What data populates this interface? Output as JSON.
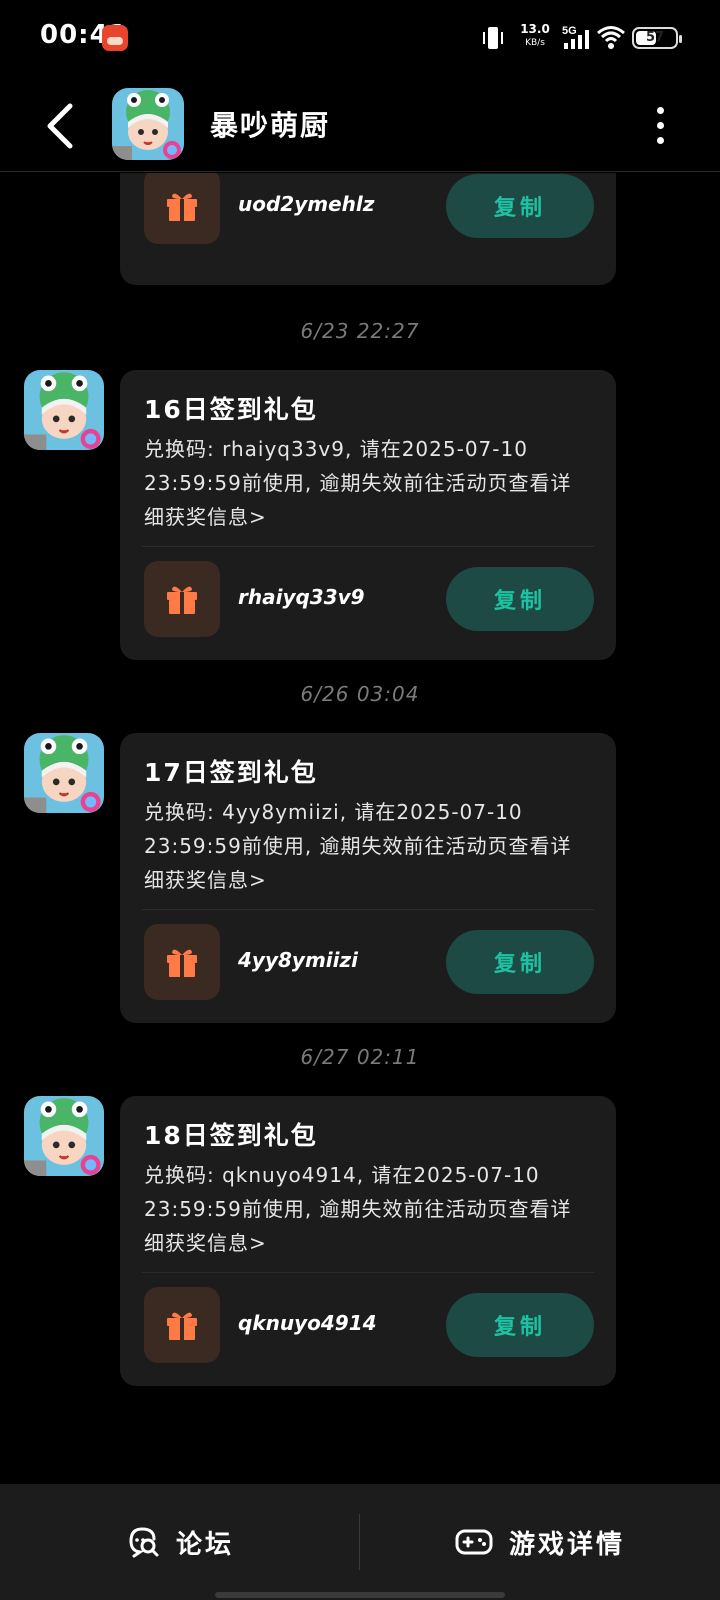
{
  "status_bar": {
    "time": "00:41",
    "net_speed_value": "13.0",
    "net_speed_unit": "KB/s",
    "network": "5G",
    "battery_level": "57",
    "battery_fraction": 0.57
  },
  "header": {
    "title": "暴吵萌厨"
  },
  "colors": {
    "background": "#000000",
    "card": "#1c1c1c",
    "copy_button_bg": "#1d4a45",
    "copy_button_text": "#1ec2a2",
    "gift_icon": "#ff7a45",
    "gift_icon_bg": "#3a2a22",
    "timestamp": "#7a7a7a"
  },
  "messages": [
    {
      "partial": true,
      "gift_code": "uod2ymehlz",
      "copy_label": "复制"
    },
    {
      "timestamp": "6/23  22:27",
      "title": "16日签到礼包",
      "body": "兑换码: rhaiyq33v9, 请在2025-07-10 23:59:59前使用, 逾期失效前往活动页查看详细获奖信息>",
      "gift_code": "rhaiyq33v9",
      "copy_label": "复制"
    },
    {
      "timestamp": "6/26  03:04",
      "title": "17日签到礼包",
      "body": "兑换码: 4yy8ymiizi, 请在2025-07-10 23:59:59前使用, 逾期失效前往活动页查看详细获奖信息>",
      "gift_code": "4yy8ymiizi",
      "copy_label": "复制"
    },
    {
      "timestamp": "6/27  02:11",
      "title": "18日签到礼包",
      "body": "兑换码: qknuyo4914, 请在2025-07-10 23:59:59前使用, 逾期失效前往活动页查看详细获奖信息>",
      "gift_code": "qknuyo4914",
      "copy_label": "复制"
    }
  ],
  "bottom_nav": {
    "forum_label": "论坛",
    "detail_label": "游戏详情"
  },
  "icons": {
    "back": "chevron-left-icon",
    "more": "more-vertical-icon",
    "gift": "gift-icon",
    "forum": "chat-search-icon",
    "game": "gamepad-icon"
  }
}
